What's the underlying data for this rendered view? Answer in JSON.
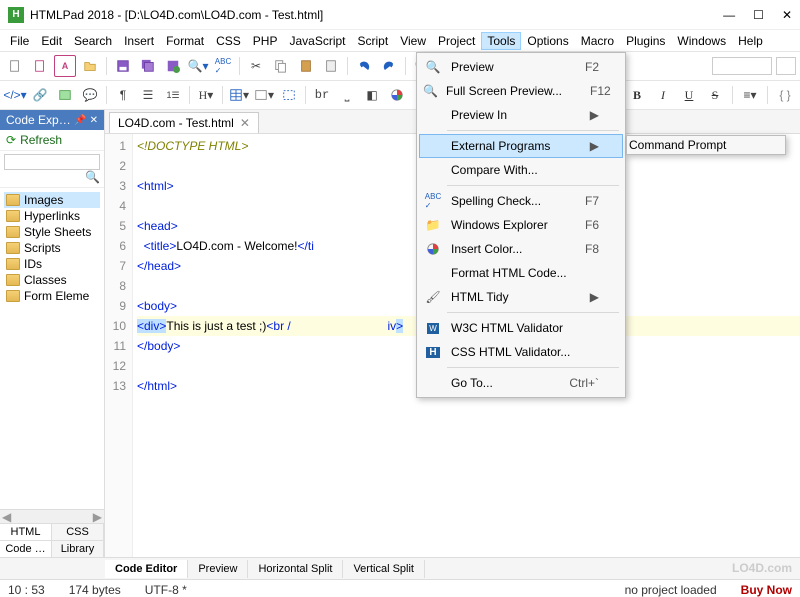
{
  "title": "HTMLPad 2018 - [D:\\LO4D.com\\LO4D.com - Test.html]",
  "menubar": [
    "File",
    "Edit",
    "Search",
    "Insert",
    "Format",
    "CSS",
    "PHP",
    "JavaScript",
    "Script",
    "View",
    "Project",
    "Tools",
    "Options",
    "Macro",
    "Plugins",
    "Windows",
    "Help"
  ],
  "menubar_open_index": 11,
  "tools_menu": [
    {
      "type": "item",
      "icon": "search-icon",
      "label": "Preview",
      "shortcut": "F2"
    },
    {
      "type": "item",
      "icon": "search-icon",
      "label": "Full Screen Preview...",
      "shortcut": "F12"
    },
    {
      "type": "sub",
      "icon": "",
      "label": "Preview In"
    },
    {
      "type": "sep"
    },
    {
      "type": "sub",
      "icon": "",
      "label": "External Programs",
      "highlight": true
    },
    {
      "type": "item",
      "icon": "",
      "label": "Compare With..."
    },
    {
      "type": "sep"
    },
    {
      "type": "item",
      "icon": "abc-icon",
      "label": "Spelling Check...",
      "shortcut": "F7"
    },
    {
      "type": "item",
      "icon": "folder-icon",
      "label": "Windows Explorer",
      "shortcut": "F6"
    },
    {
      "type": "item",
      "icon": "color-icon",
      "label": "Insert Color...",
      "shortcut": "F8"
    },
    {
      "type": "item",
      "icon": "",
      "label": "Format HTML Code..."
    },
    {
      "type": "sub",
      "icon": "brush-icon",
      "label": "HTML Tidy"
    },
    {
      "type": "sep"
    },
    {
      "type": "item",
      "icon": "w3c-icon",
      "label": "W3C HTML Validator"
    },
    {
      "type": "item",
      "icon": "h-icon",
      "label": "CSS HTML Validator..."
    },
    {
      "type": "sep"
    },
    {
      "type": "item",
      "icon": "",
      "label": "Go To...",
      "shortcut": "Ctrl+`"
    }
  ],
  "submenu_label": "Command Prompt",
  "sidebar": {
    "title": "Code Exp…",
    "refresh": "Refresh",
    "search_placeholder": "",
    "items": [
      "Images",
      "Hyperlinks",
      "Style Sheets",
      "Scripts",
      "IDs",
      "Classes",
      "Form Eleme"
    ],
    "bottom_tabs1": [
      "HTML",
      "CSS"
    ],
    "bottom_tabs2": [
      "Code …",
      "Library"
    ]
  },
  "doc_tab": "LO4D.com - Test.html",
  "code_lines": [
    {
      "n": 1,
      "segs": [
        {
          "t": "<!DOCTYPE HTML>",
          "c": "doctype"
        }
      ]
    },
    {
      "n": 2,
      "segs": []
    },
    {
      "n": 3,
      "segs": [
        {
          "t": "<html>",
          "c": "tag"
        }
      ]
    },
    {
      "n": 4,
      "segs": []
    },
    {
      "n": 5,
      "segs": [
        {
          "t": "<head>",
          "c": "tag"
        }
      ]
    },
    {
      "n": 6,
      "segs": [
        {
          "t": "  ",
          "c": "txt"
        },
        {
          "t": "<title>",
          "c": "tag"
        },
        {
          "t": "LO4D.com - Welcome!",
          "c": "txt"
        },
        {
          "t": "</ti",
          "c": "tag"
        }
      ]
    },
    {
      "n": 7,
      "segs": [
        {
          "t": "</head>",
          "c": "tag"
        }
      ]
    },
    {
      "n": 8,
      "segs": []
    },
    {
      "n": 9,
      "segs": [
        {
          "t": "<body>",
          "c": "tag"
        }
      ]
    },
    {
      "n": 10,
      "hl": true,
      "segs": [
        {
          "t": "<div>",
          "c": "tag",
          "bh": "start"
        },
        {
          "t": "This is just a test ;)",
          "c": "txt"
        },
        {
          "t": "<br /",
          "c": "tag"
        },
        {
          "t": "                             ",
          "c": "txt"
        },
        {
          "t": "iv",
          "c": "tag"
        },
        {
          "t": ">",
          "c": "tag",
          "bh": "end"
        }
      ]
    },
    {
      "n": 11,
      "segs": [
        {
          "t": "</body>",
          "c": "tag"
        }
      ]
    },
    {
      "n": 12,
      "segs": []
    },
    {
      "n": 13,
      "segs": [
        {
          "t": "</html>",
          "c": "tag"
        }
      ]
    }
  ],
  "bottom_tabs": [
    "Code Editor",
    "Preview",
    "Horizontal Split",
    "Vertical Split"
  ],
  "status": {
    "pos": "10 : 53",
    "size": "174 bytes",
    "enc": "UTF-8 *",
    "proj": "no project loaded",
    "buy": "Buy Now"
  },
  "watermark": "LO4D.com"
}
